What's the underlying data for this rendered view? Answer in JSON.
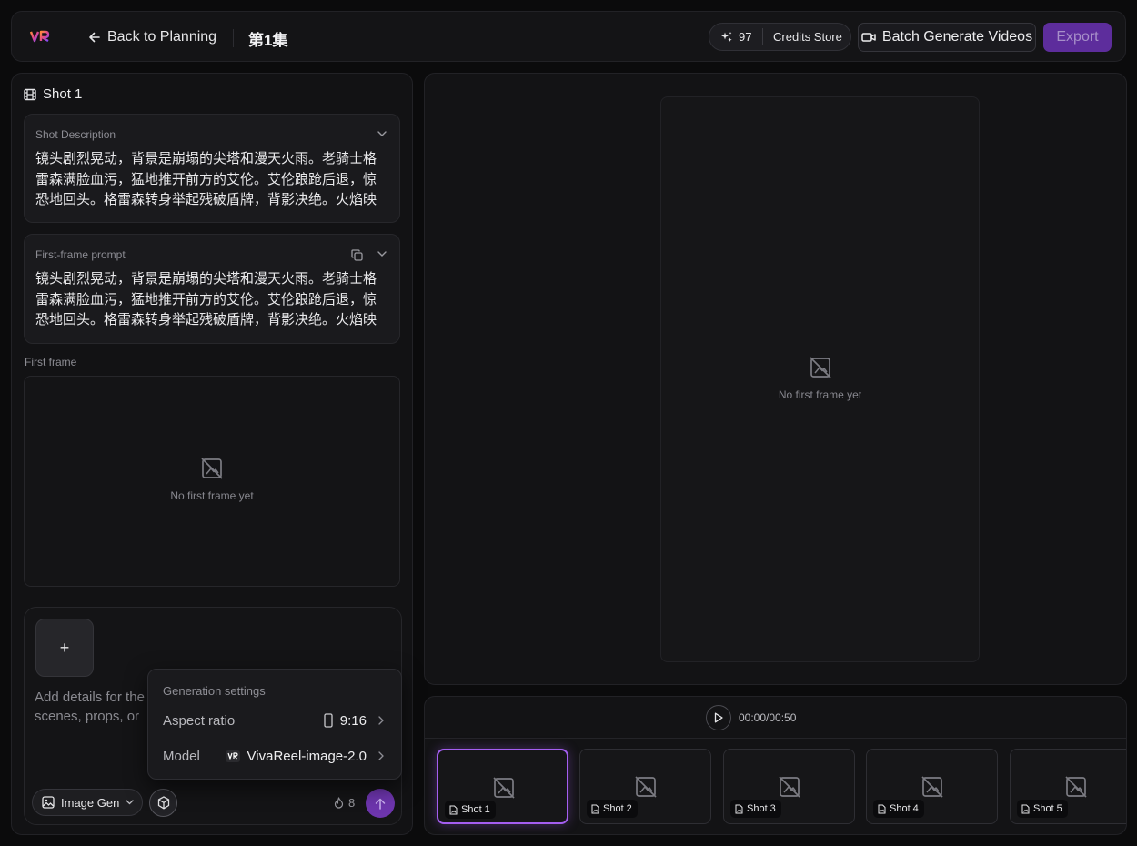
{
  "header": {
    "logo": "VR",
    "back_label": "Back to Planning",
    "episode_title": "第1集",
    "credits": "97",
    "credits_store_label": "Credits Store",
    "batch_label": "Batch Generate Videos",
    "export_label": "Export"
  },
  "shot": {
    "title": "Shot 1",
    "description_label": "Shot Description",
    "description_text": "镜头剧烈晃动，背景是崩塌的尖塔和漫天火雨。老骑士格雷森满脸血污，猛地推开前方的艾伦。艾伦踉跄后退，惊恐地回头。格雷森转身举起残破盾牌，背影决绝。火焰映红了两人...",
    "first_frame_prompt_label": "First-frame prompt",
    "first_frame_prompt_text": "镜头剧烈晃动，背景是崩塌的尖塔和漫天火雨。老骑士格雷森满脸血污，猛地推开前方的艾伦。艾伦踉跄后退，惊恐地回头。格雷森转身举起残破盾牌，背影决绝。火焰映红了两人...",
    "first_frame_label": "First frame",
    "empty_text": "No first frame yet"
  },
  "composer": {
    "add_label": "+",
    "placeholder": "Add details for the scenes, props, or re",
    "mode_label": "Image Gen",
    "cost": "8"
  },
  "generation_settings": {
    "title": "Generation settings",
    "aspect_label": "Aspect ratio",
    "aspect_value": "9:16",
    "model_label": "Model",
    "model_value": "VivaReel-image-2.0"
  },
  "preview": {
    "empty_text": "No first frame yet"
  },
  "timeline": {
    "time": "00:00/00:50",
    "shots": [
      {
        "label": "Shot 1",
        "selected": true
      },
      {
        "label": "Shot 2",
        "selected": false
      },
      {
        "label": "Shot 3",
        "selected": false
      },
      {
        "label": "Shot 4",
        "selected": false
      },
      {
        "label": "Shot 5",
        "selected": false
      }
    ]
  },
  "colors": {
    "accent": "#6d35ad",
    "selected_border": "#a45ef0",
    "background": "#0b0b0c"
  }
}
